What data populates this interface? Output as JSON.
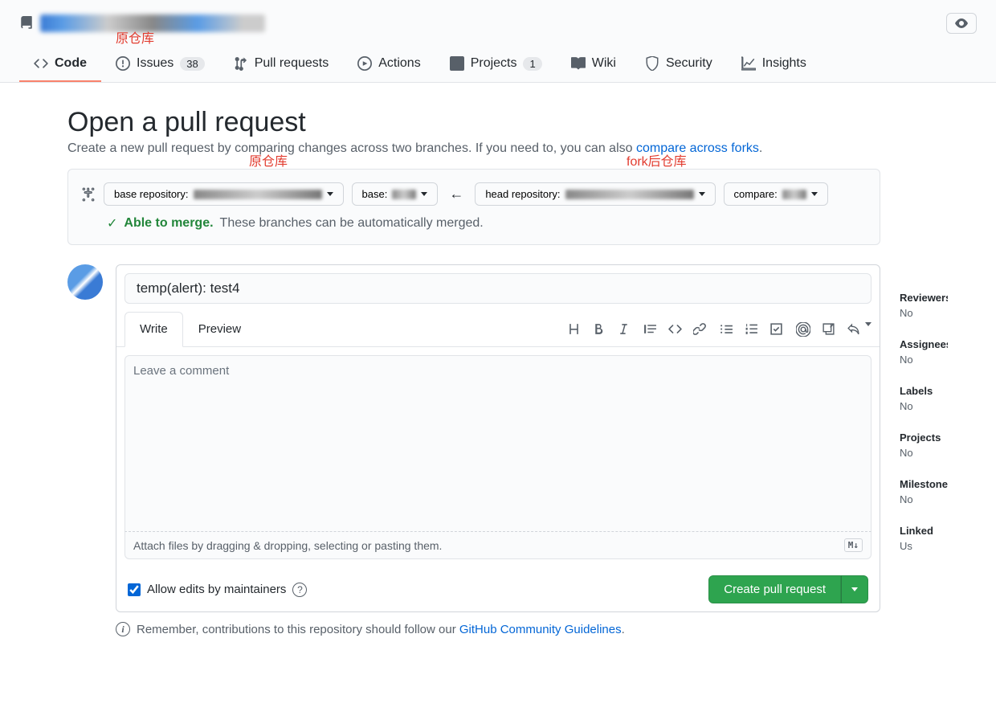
{
  "annotations": {
    "origRepo": "原仓库",
    "origRepo2": "原仓库",
    "forkRepo": "fork后仓库"
  },
  "tabs": [
    {
      "label": "Code",
      "count": null,
      "active": true
    },
    {
      "label": "Issues",
      "count": "38"
    },
    {
      "label": "Pull requests",
      "count": null
    },
    {
      "label": "Actions",
      "count": null
    },
    {
      "label": "Projects",
      "count": "1"
    },
    {
      "label": "Wiki",
      "count": null
    },
    {
      "label": "Security",
      "count": null
    },
    {
      "label": "Insights",
      "count": null
    }
  ],
  "page": {
    "title": "Open a pull request",
    "subtitle_pre": "Create a new pull request by comparing changes across two branches. If you need to, you can also ",
    "subtitle_link": "compare across forks",
    "subtitle_post": "."
  },
  "compare": {
    "baseRepoLabel": "base repository:",
    "baseLabel": "base:",
    "headRepoLabel": "head repository:",
    "compareLabel": "compare:"
  },
  "mergeStatus": {
    "able": "Able to merge.",
    "msg": "These branches can be automatically merged."
  },
  "form": {
    "title": "temp(alert): test4",
    "writeTab": "Write",
    "previewTab": "Preview",
    "commentPlaceholder": "Leave a comment",
    "attachHint": "Attach files by dragging & dropping, selecting or pasting them.",
    "mdBadge": "M↓",
    "allowEdits": "Allow edits by maintainers",
    "submitBtn": "Create pull request"
  },
  "guidelines": {
    "pre": "Remember, contributions to this repository should follow our ",
    "link": "GitHub Community Guidelines",
    "post": "."
  },
  "sidebar": [
    {
      "label": "Reviewers",
      "value": "No"
    },
    {
      "label": "Assignees",
      "value": "No"
    },
    {
      "label": "Labels",
      "value": "No"
    },
    {
      "label": "Projects",
      "value": "No"
    },
    {
      "label": "Milestone",
      "value": "No"
    },
    {
      "label": "Linked",
      "value": "Us"
    }
  ]
}
